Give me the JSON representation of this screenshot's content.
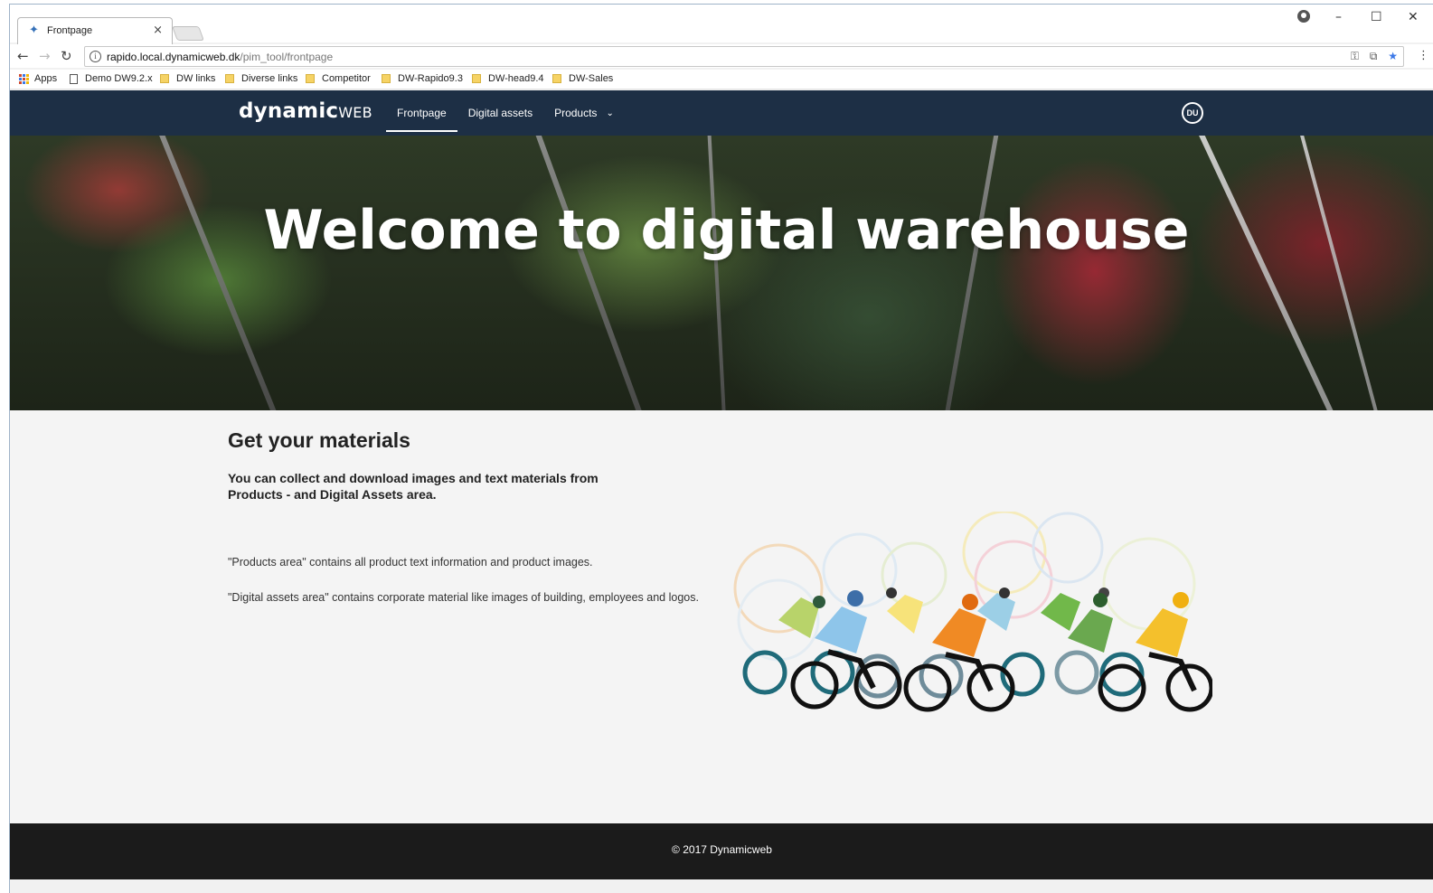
{
  "browser": {
    "tab_title": "Frontpage",
    "tab_close": "×",
    "url_host": "rapido.local.dynamicweb.dk",
    "url_path": "/pim_tool/frontpage",
    "window_controls": {
      "minimize": "–",
      "maximize": "☐",
      "close": "✕"
    },
    "bookmarks": [
      {
        "label": "Apps",
        "icon": "apps-grid-icon"
      },
      {
        "label": "Demo DW9.2.x",
        "icon": "page-icon"
      },
      {
        "label": "DW links",
        "icon": "folder-icon"
      },
      {
        "label": "Diverse links",
        "icon": "folder-icon"
      },
      {
        "label": "Competitor",
        "icon": "folder-icon"
      },
      {
        "label": "DW-Rapido9.3",
        "icon": "folder-icon"
      },
      {
        "label": "DW-head9.4",
        "icon": "folder-icon"
      },
      {
        "label": "DW-Sales",
        "icon": "folder-icon"
      }
    ]
  },
  "site": {
    "logo_main": "dynamic",
    "logo_suffix": "web",
    "nav": [
      {
        "label": "Frontpage",
        "active": true
      },
      {
        "label": "Digital assets",
        "active": false
      },
      {
        "label": "Products",
        "active": false,
        "has_dropdown": true
      }
    ],
    "avatar_initials": "DU"
  },
  "hero": {
    "title": "Welcome to digital warehouse"
  },
  "main": {
    "heading": "Get your materials",
    "lead": "You can collect and download images and text materials from Products - and Digital Assets area.",
    "paragraphs": [
      "\"Products area\" contains all product text information and product images.",
      "\"Digital assets area\" contains corporate material like images of building, employees and logos."
    ]
  },
  "footer": {
    "copyright": "© 2017 Dynamicweb"
  },
  "colors": {
    "header_bg": "#1d2f45",
    "footer_bg": "#1b1b1b",
    "content_bg": "#f4f4f4"
  }
}
